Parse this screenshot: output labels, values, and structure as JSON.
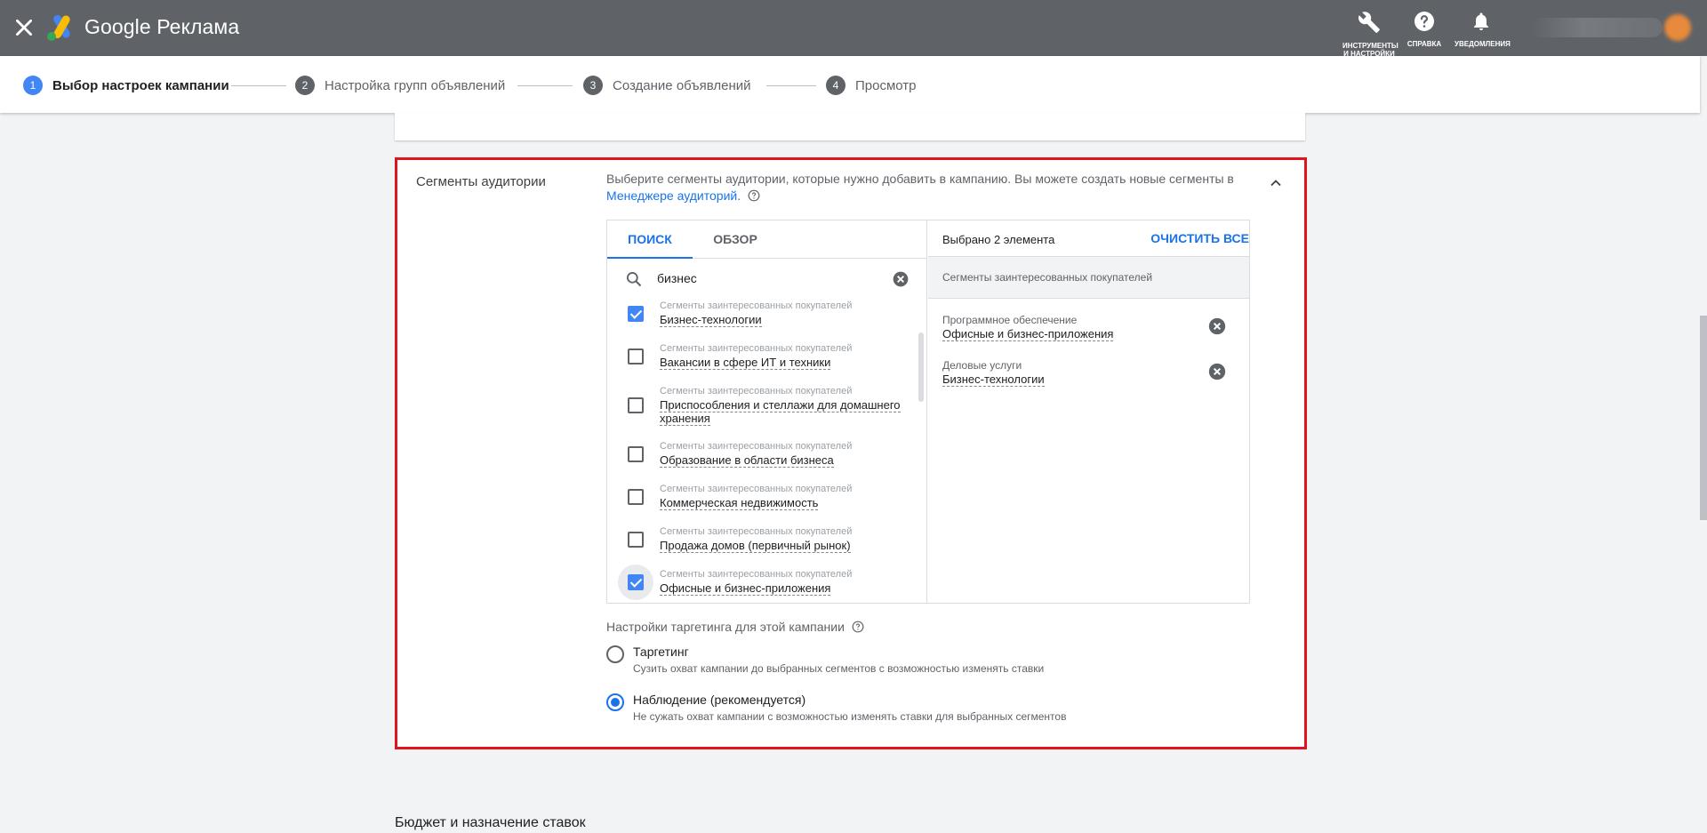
{
  "app": {
    "title": "Google Реклама"
  },
  "header_tools": [
    {
      "icon": "wrench-icon",
      "label": "ИНСТРУМЕНТЫ И НАСТРОЙКИ"
    },
    {
      "icon": "help-icon",
      "label": "СПРАВКА"
    },
    {
      "icon": "bell-icon",
      "label": "УВЕДОМЛЕНИЯ"
    }
  ],
  "steps": [
    {
      "num": "1",
      "label": "Выбор настроек кампании",
      "active": true
    },
    {
      "num": "2",
      "label": "Настройка групп объявлений"
    },
    {
      "num": "3",
      "label": "Создание объявлений"
    },
    {
      "num": "4",
      "label": "Просмотр"
    }
  ],
  "section": {
    "title": "Сегменты аудитории",
    "description": "Выберите сегменты аудитории, которые нужно добавить в кампанию. Вы можете создать новые сегменты в",
    "link": "Менеджере аудиторий",
    "link_suffix": "."
  },
  "tabs": {
    "search": "ПОИСК",
    "browse": "ОБЗОР"
  },
  "search": {
    "value": "бизнес"
  },
  "results": [
    {
      "category": "Сегменты заинтересованных покупателей",
      "name": "Бизнес-технологии",
      "checked": true
    },
    {
      "category": "Сегменты заинтересованных покупателей",
      "name": "Вакансии в сфере ИТ и техники",
      "checked": false
    },
    {
      "category": "Сегменты заинтересованных покупателей",
      "name": "Приспособления и стеллажи для домашнего хранения",
      "checked": false
    },
    {
      "category": "Сегменты заинтересованных покупателей",
      "name": "Образование в области бизнеса",
      "checked": false
    },
    {
      "category": "Сегменты заинтересованных покупателей",
      "name": "Коммерческая недвижимость",
      "checked": false
    },
    {
      "category": "Сегменты заинтересованных покупателей",
      "name": "Продажа домов (первичный рынок)",
      "checked": false
    },
    {
      "category": "Сегменты заинтересованных покупателей",
      "name": "Офисные и бизнес-приложения",
      "checked": true
    }
  ],
  "selected": {
    "count_label": "Выбрано 2 элемента",
    "clear_all": "ОЧИСТИТЬ ВСЕ",
    "group": "Сегменты заинтересованных покупателей",
    "items": [
      {
        "category": "Программное обеспечение",
        "name": "Офисные и бизнес-приложения"
      },
      {
        "category": "Деловые услуги",
        "name": "Бизнес-технологии"
      }
    ]
  },
  "targeting": {
    "title": "Настройки таргетинга для этой кампании",
    "options": [
      {
        "label": "Таргетинг",
        "desc": "Сузить охват кампании до выбранных сегментов с возможностью изменять ставки",
        "selected": false
      },
      {
        "label": "Наблюдение (рекомендуется)",
        "desc": "Не сужать охват кампании с возможностью изменять ставки для выбранных сегментов",
        "selected": true
      }
    ]
  },
  "next_section": {
    "title": "Бюджет и назначение ставок"
  },
  "colors": {
    "accent": "#1a73e8",
    "highlight_border": "#e0141e",
    "topbar": "#5f6368"
  }
}
